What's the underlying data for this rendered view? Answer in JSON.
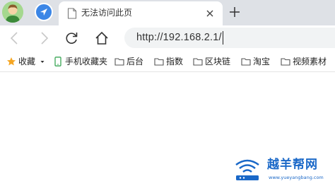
{
  "tab": {
    "title": "无法访问此页"
  },
  "address_bar": {
    "url": "http://192.168.2.1/"
  },
  "bookmarks": [
    {
      "label": "收藏",
      "icon": "star-icon"
    },
    {
      "label": "手机收藏夹",
      "icon": "phone-icon"
    },
    {
      "label": "后台",
      "icon": "folder-icon"
    },
    {
      "label": "指数",
      "icon": "folder-icon"
    },
    {
      "label": "区块链",
      "icon": "folder-icon"
    },
    {
      "label": "淘宝",
      "icon": "folder-icon"
    },
    {
      "label": "视频素材",
      "icon": "folder-icon"
    }
  ],
  "watermark": {
    "name": "越羊帮网",
    "url": "www.yueyangbang.com"
  },
  "colors": {
    "tabstrip_bg": "#dee1e6",
    "address_bg": "#f1f3f4",
    "watermark_blue": "#1a68c8",
    "star": "#f5a623",
    "phone": "#3aa655"
  }
}
